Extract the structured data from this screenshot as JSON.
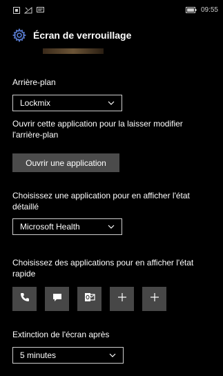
{
  "status_bar": {
    "time": "09:55",
    "icons": [
      "notification-icon",
      "signal-icon",
      "message-icon",
      "battery-icon"
    ]
  },
  "header": {
    "title": "Écran de verrouillage",
    "icon": "gear-icon",
    "accent_color": "#5b7fd6"
  },
  "background": {
    "label": "Arrière-plan",
    "selected": "Lockmix",
    "description": "Ouvrir cette application pour la laisser modifier l'arrière-plan",
    "button_label": "Ouvrir une application"
  },
  "detailed_status": {
    "label": "Choisissez une application pour en afficher l'état détaillé",
    "selected": "Microsoft Health"
  },
  "quick_status": {
    "label": "Choisissez des applications pour en afficher l'état rapide",
    "tiles": [
      "phone-icon",
      "message-icon",
      "outlook-icon",
      "add-icon",
      "add-icon"
    ]
  },
  "screen_timeout": {
    "label": "Extinction de l'écran après",
    "selected": "5 minutes"
  }
}
